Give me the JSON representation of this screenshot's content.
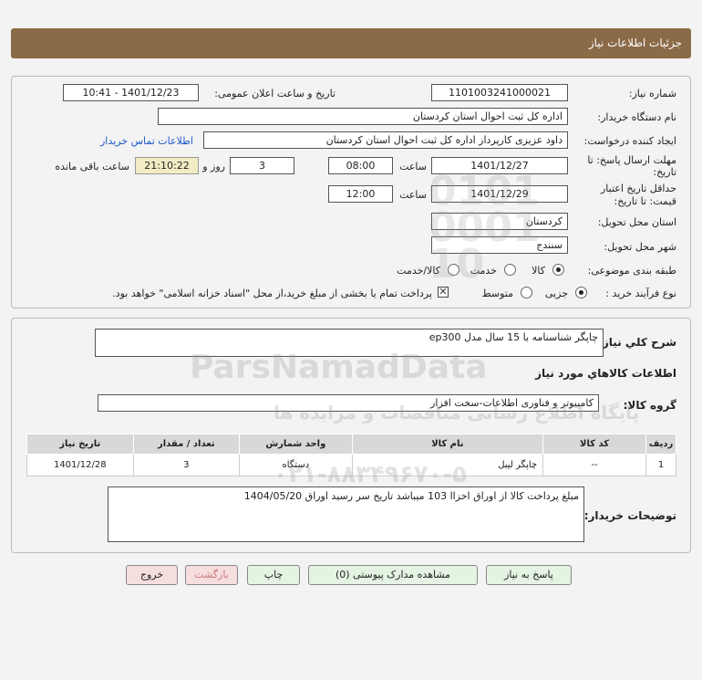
{
  "page": {
    "title": "جزئیات اطلاعات نیاز"
  },
  "header": {
    "need_number_label": "شماره نیاز:",
    "need_number": "1101003241000021",
    "announce_label": "تاریخ و ساعت اعلان عمومی:",
    "announce_value": "1401/12/23 - 10:41",
    "buyer_label": "نام دستگاه خریدار:",
    "buyer_value": "اداره کل ثبت احوال استان کردستان",
    "creator_label": "ایجاد کننده درخواست:",
    "creator_value": "داود عزیزی کارپرداز اداره کل ثبت احوال استان کردستان",
    "contact_link": "اطلاعات تماس خریدار",
    "deadline_label_1": "مهلت ارسال پاسخ: تا",
    "deadline_label_2": "تاریخ:",
    "deadline_date": "1401/12/27",
    "time_label": "ساعت",
    "deadline_time": "08:00",
    "days_value": "3",
    "days_label": "روز و",
    "remaining_time": "21:10:22",
    "remaining_label": "ساعت باقی مانده",
    "validity_label_1": "حداقل تاریخ اعتبار",
    "validity_label_2": "قیمت: تا تاریخ:",
    "validity_date": "1401/12/29",
    "validity_time": "12:00",
    "province_label": "استان محل تحویل:",
    "province_value": "کردستان",
    "city_label": "شهر محل تحویل:",
    "city_value": "سنندج",
    "category_label": "طبقه بندی موضوعی:",
    "category_options": [
      "کالا",
      "خدمت",
      "کالا/خدمت"
    ],
    "process_label": "نوع فرآیند خرید :",
    "process_options": [
      "جزیی",
      "متوسط"
    ],
    "payment_text": "پرداخت تمام یا بخشی از مبلغ خرید،از محل \"اسناد خزانه اسلامی\" خواهد بود."
  },
  "details": {
    "summary_label": "شرح کلي نياز:",
    "summary_value": "چاپگر شناسنامه با 15 سال مدل ep300",
    "items_heading": "اطلاعات کالاهاي مورد نياز",
    "group_label": "گروه کالا:",
    "group_value": "کامپیوتر و فناوری اطلاعات-سخت افزار",
    "table": {
      "headers": [
        "ردیف",
        "کد کالا",
        "نام کالا",
        "واحد شمارش",
        "تعداد / مقدار",
        "تاریخ نیاز"
      ],
      "rows": [
        [
          "1",
          "--",
          "چاپگر لیبل",
          "دستگاه",
          "3",
          "1401/12/28"
        ]
      ]
    },
    "buyer_notes_label": "توضیحات خریدار:",
    "buyer_notes_value": "مبلغ پرداخت کالا از اوراق اخزاا 103 میباشد تاریخ سر رسید اوراق 1404/05/20"
  },
  "buttons": {
    "reply": "پاسخ به نیاز",
    "attachments": "مشاهده مدارک پیوستی (0)",
    "print": "چاپ",
    "back": "بازگشت",
    "exit": "خروج"
  },
  "watermark": {
    "line1": "ParsNamadData",
    "line2": "پایگاه اطلاع رسانی مناقصات و مزایده ها",
    "line3": "۰۲۱-۸۸۳۴۹۶۷۰-۵"
  }
}
